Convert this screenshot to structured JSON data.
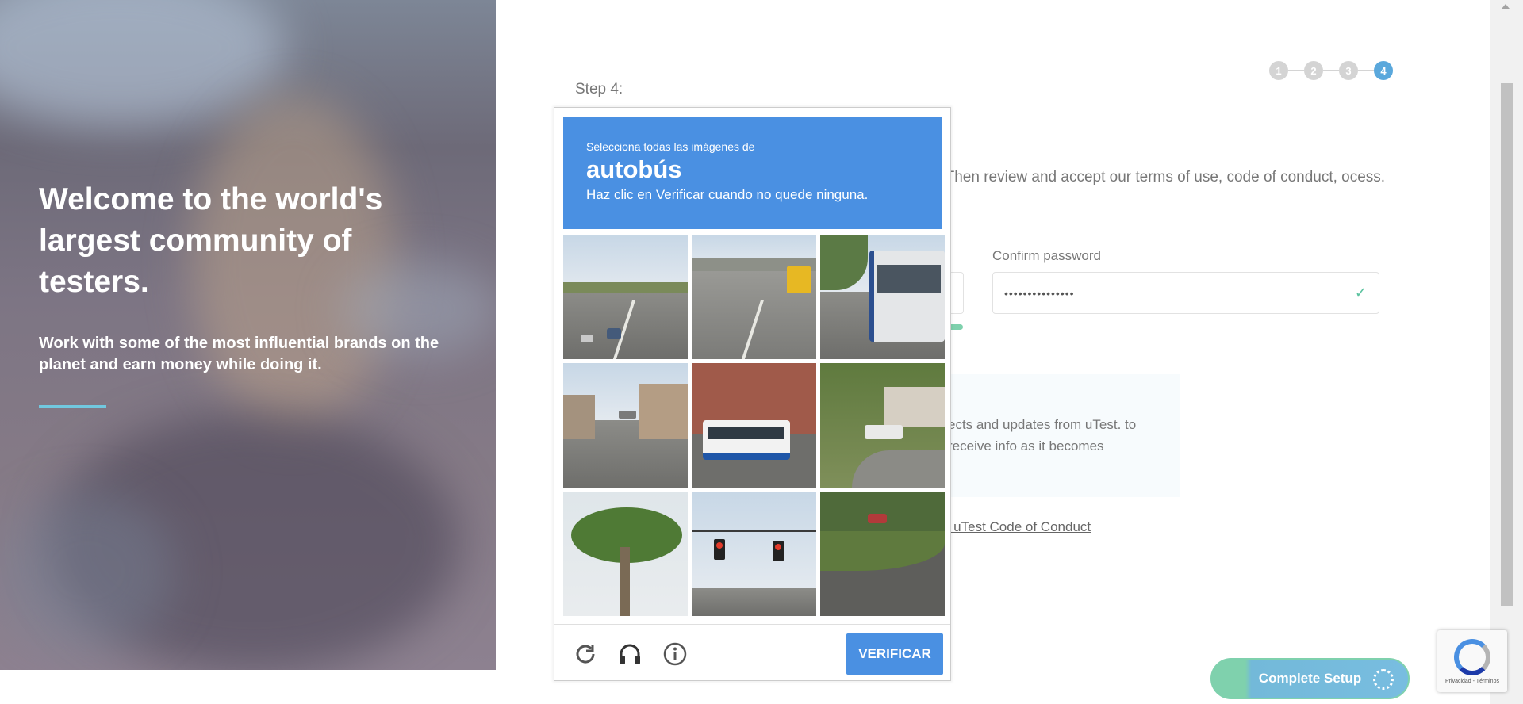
{
  "hero": {
    "title": "Welcome to the world's largest community of testers.",
    "subtitle": "Work with some of the most influential brands on the planet and earn money while doing it."
  },
  "form": {
    "step_label": "Step 4:",
    "steps": [
      "1",
      "2",
      "3",
      "4"
    ],
    "active_step": "4",
    "intro_text": "unt. Then review and accept our terms of use, code of conduct, ocess.",
    "confirm_password_label": "Confirm password",
    "confirm_password_value": "•••••••••••••••",
    "info_text": "ects and updates from uTest. to receive info as it becomes",
    "code_of_conduct_link": "e uTest Code of Conduct",
    "complete_button": "Complete Setup"
  },
  "captcha": {
    "instruction_small": "Selecciona todas las imágenes de",
    "target_word": "autobús",
    "instruction_note": "Haz clic en Verificar cuando no quede ninguna.",
    "tiles": [
      "highway-cars",
      "highway-overpass-bus",
      "bus-side",
      "city-intersection",
      "city-bus",
      "house-truck",
      "palm-tree",
      "traffic-lights",
      "street-car"
    ],
    "verify_button": "VERIFICAR",
    "accent_color": "#4a90e2"
  },
  "recaptcha_badge": {
    "terms": "Privacidad - Términos"
  }
}
